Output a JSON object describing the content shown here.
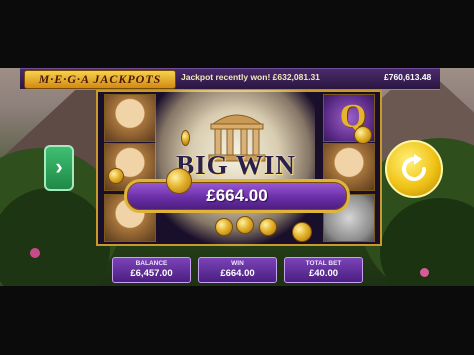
{
  "jackpot_bar": {
    "logo": "M·E·G·A JACKPOTS",
    "message": "Jackpot recently won! £632,081.31",
    "amount": "£760,613.48"
  },
  "big_win": {
    "title": "BIG WIN",
    "amount": "£664.00"
  },
  "reels": {
    "visible_letter_symbol": "Q"
  },
  "info_bar": {
    "balance_label": "BALANCE",
    "balance_value": "£6,457.00",
    "win_label": "WIN",
    "win_value": "£664.00",
    "total_bet_label": "TOTAL BET",
    "total_bet_value": "£40.00"
  },
  "buttons": {
    "left_arrow": "›",
    "spin_icon": "refresh-arrow-icon"
  },
  "colors": {
    "accent_gold": "#e0b43a",
    "panel_purple": "#6a2fa7",
    "spin_green": "#2fa85c",
    "spin_yellow": "#f0c316"
  }
}
